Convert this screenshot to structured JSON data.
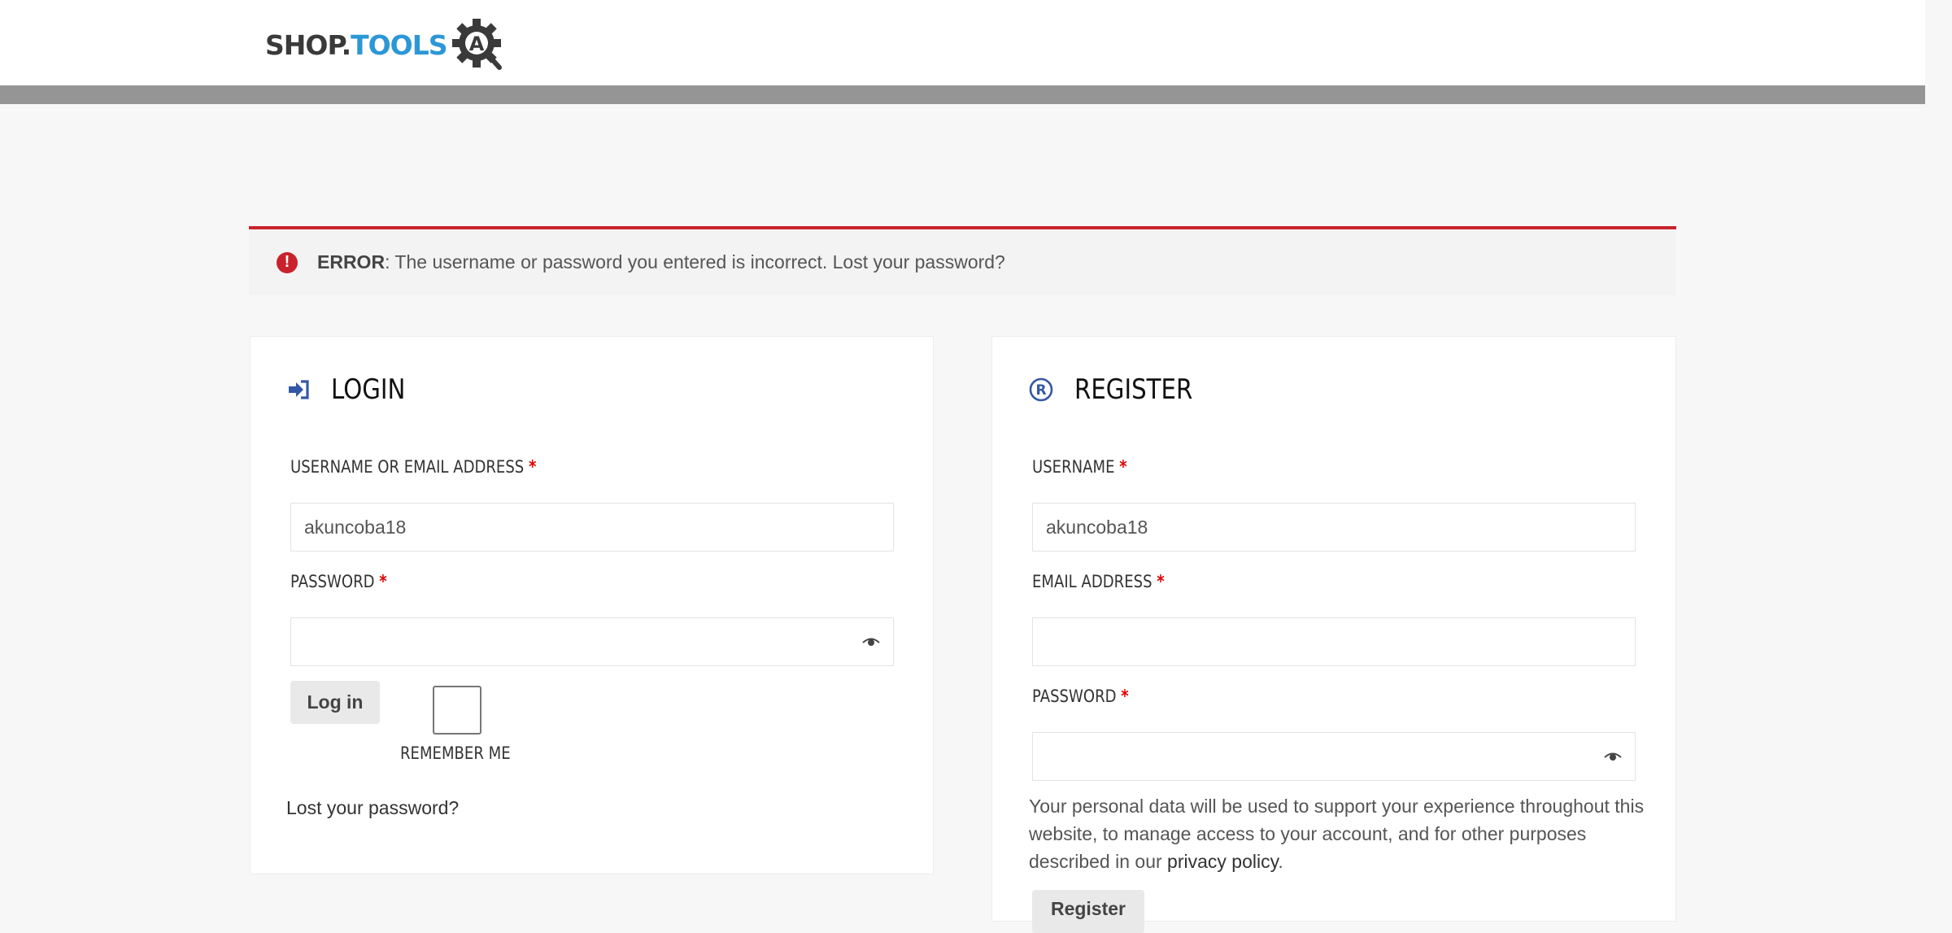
{
  "site": {
    "logo_left": "SHOP.",
    "logo_right": "TOOLS",
    "logo_badge": "A"
  },
  "error": {
    "label": "ERROR",
    "message": ": The username or password you entered is incorrect. Lost your password?",
    "color": "#c8232c"
  },
  "login": {
    "title": "LOGIN",
    "username_label": "USERNAME OR EMAIL ADDRESS",
    "username_value": "akuncoba18",
    "password_label": "PASSWORD",
    "password_value": "",
    "submit_label": "Log in",
    "remember_label": "REMEMBER ME",
    "lost_password": "Lost your password?"
  },
  "register": {
    "title": "REGISTER",
    "username_label": "USERNAME",
    "username_value": "akuncoba18",
    "email_label": "EMAIL ADDRESS",
    "email_value": "",
    "password_label": "PASSWORD",
    "password_value": "",
    "privacy_text": "Your personal data will be used to support your experience throughout this website, to manage access to your account, and for other purposes described in our ",
    "privacy_link": "privacy policy",
    "privacy_end": ".",
    "submit_label": "Register"
  },
  "required_marker": "*",
  "icons": {
    "login": "sign-in-icon",
    "register": "registered-icon",
    "error": "exclamation-circle-icon",
    "password_toggle": "eye-icon"
  },
  "colors": {
    "accent_blue": "#3457a6",
    "logo_blue": "#2c97d6",
    "required": "#e00000"
  }
}
